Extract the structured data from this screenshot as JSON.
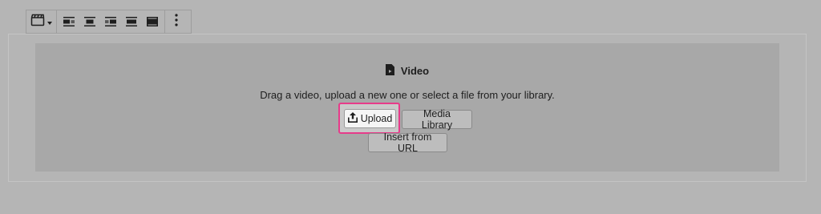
{
  "toolbar": {
    "block_switcher_icon": "video-clapper-icon",
    "align_buttons": [
      {
        "name": "align-left-icon"
      },
      {
        "name": "align-center-icon"
      },
      {
        "name": "align-right-icon"
      },
      {
        "name": "align-wide-icon"
      },
      {
        "name": "align-full-icon"
      }
    ],
    "more_icon": "more-vertical-icon"
  },
  "placeholder": {
    "label": "Video",
    "icon": "video-file-icon",
    "instructions": "Drag a video, upload a new one or select a file from your library."
  },
  "buttons": {
    "upload_label": "Upload",
    "upload_icon": "upload-icon",
    "media_library_label": "Media Library",
    "insert_url_label": "Insert from URL"
  },
  "colors": {
    "background": "#b5b5b5",
    "placeholder_bg": "#a8a8a8",
    "highlight": "#e73b8a",
    "text": "#1e1e1e"
  }
}
